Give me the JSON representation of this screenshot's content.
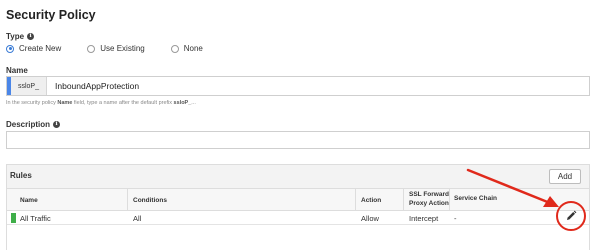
{
  "page": {
    "title": "Security Policy"
  },
  "type_section": {
    "label": "Type",
    "options": [
      {
        "label": "Create New",
        "selected": true
      },
      {
        "label": "Use Existing",
        "selected": false
      },
      {
        "label": "None",
        "selected": false
      }
    ]
  },
  "name_section": {
    "label": "Name",
    "prefix": "ssloP_",
    "value": "InboundAppProtection",
    "help_before": "In the security policy ",
    "help_bold1": "Name",
    "help_middle": " field, type a name after the default prefix ",
    "help_bold2": "ssloP_",
    "help_after": "..."
  },
  "description_section": {
    "label": "Description",
    "value": ""
  },
  "rules": {
    "title": "Rules",
    "add_label": "Add",
    "columns": {
      "name": "Name",
      "conditions": "Conditions",
      "action": "Action",
      "ssl_line1": "SSL Forward",
      "ssl_line2": "Proxy Action",
      "service_chain": "Service Chain"
    },
    "rows": [
      {
        "name": "All Traffic",
        "conditions": "All",
        "action": "Allow",
        "ssl": "Intercept",
        "service_chain": "-",
        "indicator_color": "#3fae49"
      }
    ]
  },
  "colors": {
    "accent": "#4a86e8",
    "annotation": "#e0291b",
    "status_green": "#3fae49"
  },
  "icons": {
    "info": "info-icon",
    "edit": "pencil-icon"
  }
}
